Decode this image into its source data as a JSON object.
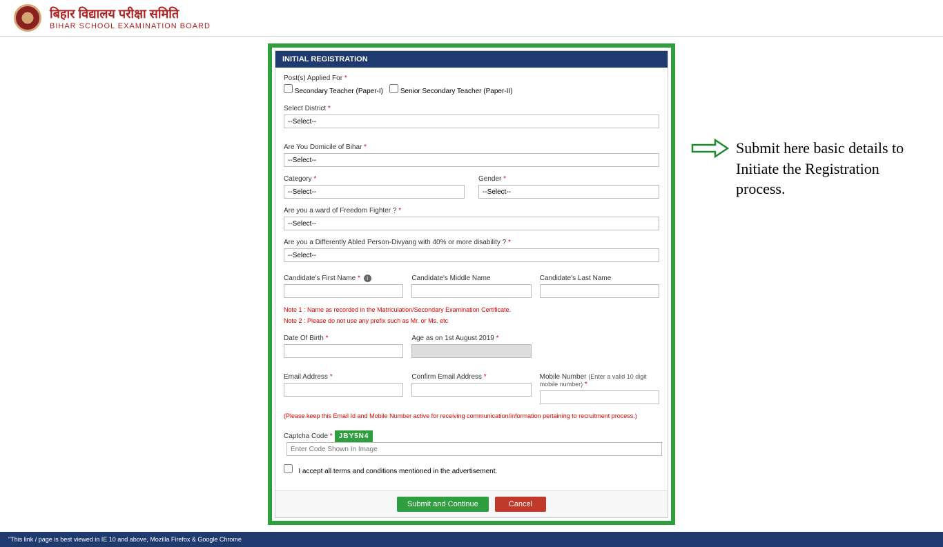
{
  "header": {
    "title_hi": "बिहार विद्यालय परीक्षा समिति",
    "title_en": "BIHAR SCHOOL EXAMINATION BOARD"
  },
  "panel": {
    "heading": "INITIAL REGISTRATION"
  },
  "labels": {
    "posts": "Post(s) Applied For",
    "post_opt1": "Secondary Teacher (Paper-I)",
    "post_opt2": "Senior Secondary Teacher (Paper-II)",
    "district": "Select District",
    "domicile": "Are You Domicile of Bihar",
    "category": "Category",
    "gender": "Gender",
    "freedom": "Are you a ward of Freedom Fighter ?",
    "disability": "Are you a Differently Abled Person-Divyang with 40% or more disability ?",
    "first_name": "Candidate's First Name",
    "middle_name": "Candidate's Middle Name",
    "last_name": "Candidate's Last Name",
    "dob": "Date Of Birth",
    "age": "Age as on 1st August 2019",
    "email": "Email Address",
    "confirm_email": "Confirm Email Address",
    "mobile": "Mobile Number",
    "mobile_hint": "(Enter a valid 10 digit mobile number)",
    "captcha": "Captcha Code",
    "captcha_placeholder": "Enter Code Shown In Image",
    "terms": "I accept all terms and conditions mentioned in the advertisement."
  },
  "select_default": "--Select--",
  "notes": {
    "name_note1": "Note 1 : Name as recorded in the Matriculation/Secondary Examination Certificate.",
    "name_note2": "Note 2 : Please do not use any prefix such as Mr. or Ms. etc",
    "email_note": "(Please keep this Email Id and Mobile Number active for receiving communication/information pertaining to recruitment process.)"
  },
  "captcha_value": "JBY5N4",
  "buttons": {
    "submit": "Submit and Continue",
    "cancel": "Cancel"
  },
  "footer": "\"This link / page is best viewed in IE 10 and above, Mozilla Firefox & Google Chrome",
  "annotation": "Submit here basic details to Initiate the Registration process."
}
